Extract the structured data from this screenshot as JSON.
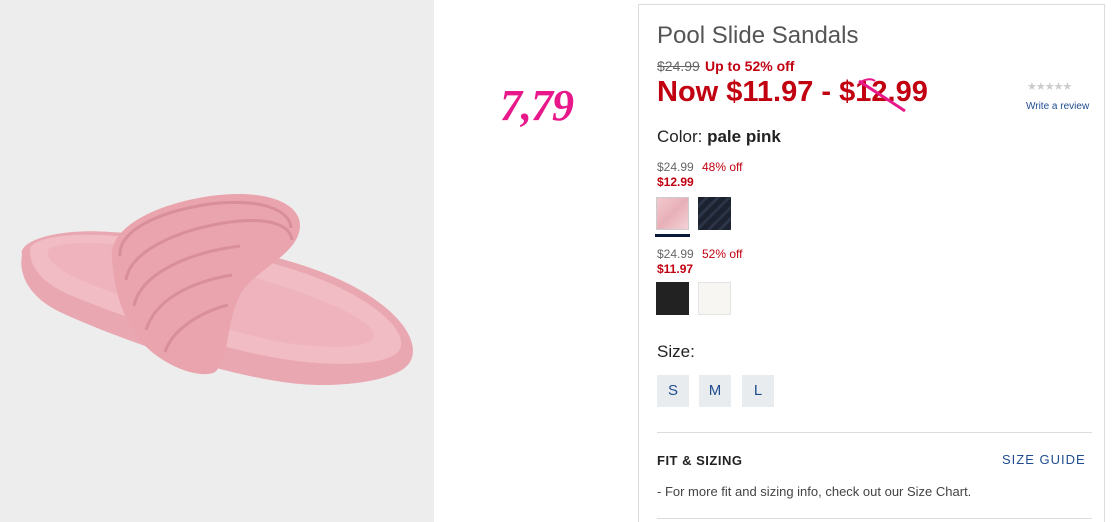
{
  "annotation": {
    "price_note": "7,79"
  },
  "product": {
    "title": "Pool Slide Sandals",
    "original_price": "$24.99",
    "discount_text": "Up to 52% off",
    "now_price": "Now $11.97 - $12.99",
    "stars": "★★★★★",
    "review_link": "Write a review",
    "color_label": "Color:",
    "color_value": "pale pink"
  },
  "color_groups": [
    {
      "original": "$24.99",
      "discount": "48% off",
      "price": "$12.99",
      "swatches": [
        "pale pink",
        "navy"
      ]
    },
    {
      "original": "$24.99",
      "discount": "52% off",
      "price": "$11.97",
      "swatches": [
        "black",
        "white"
      ]
    }
  ],
  "sizes": {
    "label": "Size:",
    "options": [
      "S",
      "M",
      "L"
    ]
  },
  "fit": {
    "title": "FIT & SIZING",
    "guide_link": "SIZE GUIDE",
    "note": "- For more fit and sizing info, check out our Size Chart."
  },
  "colors": {
    "sale_red": "#c10010",
    "link_blue": "#1f4d8f",
    "annotation_pink": "#e8188a",
    "selected_bar": "#0b1a3a"
  }
}
